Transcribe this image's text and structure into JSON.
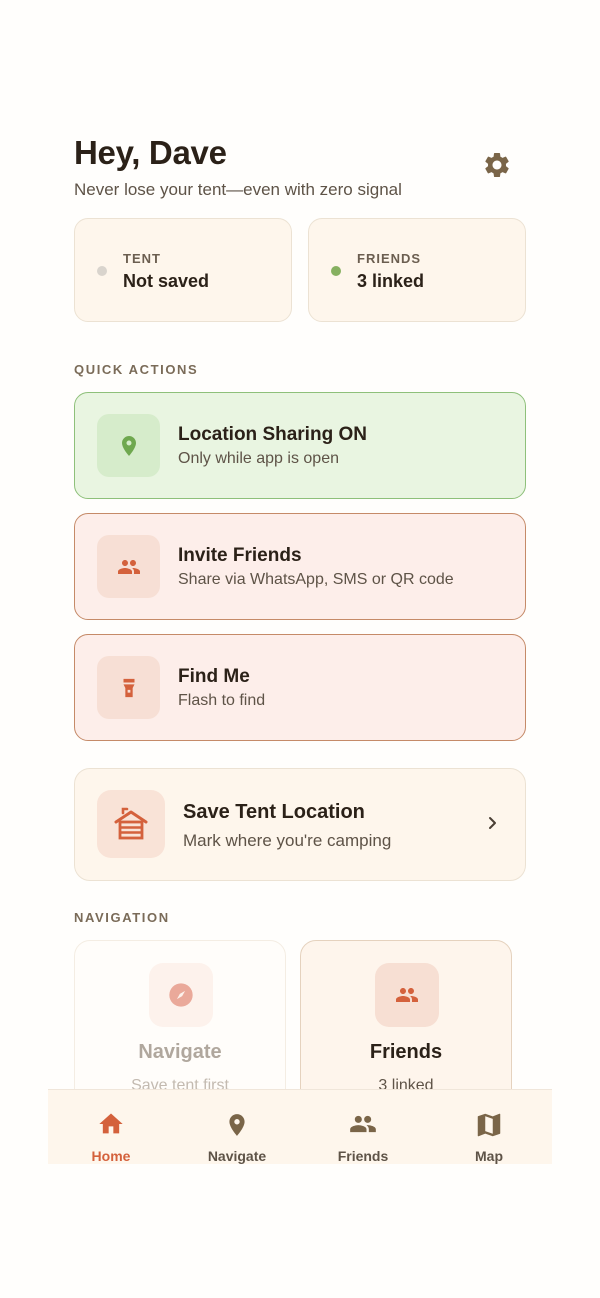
{
  "header": {
    "greeting": "Hey, Dave",
    "subtitle": "Never lose your tent—even with zero signal",
    "settings_icon": "gear-icon"
  },
  "status": {
    "tent": {
      "label": "TENT",
      "value": "Not saved",
      "dot_color": "#d9d4cd"
    },
    "friends": {
      "label": "FRIENDS",
      "value": "3 linked",
      "dot_color": "#86b060"
    }
  },
  "quick_actions": {
    "section_title": "QUICK ACTIONS",
    "items": [
      {
        "icon": "map-pin-icon",
        "title": "Location Sharing ON",
        "desc": "Only while app is open"
      },
      {
        "icon": "people-icon",
        "title": "Invite Friends",
        "desc": "Share via WhatsApp, SMS or QR code"
      },
      {
        "icon": "flashlight-icon",
        "title": "Find Me",
        "desc": "Flash to find"
      }
    ]
  },
  "save_tent": {
    "icon": "cabin-icon",
    "title": "Save Tent Location",
    "desc": "Mark where you're camping"
  },
  "navigation": {
    "section_title": "NAVIGATION",
    "cards": [
      {
        "icon": "compass-icon",
        "title": "Navigate",
        "desc": "Save tent first",
        "enabled": false
      },
      {
        "icon": "people-icon",
        "title": "Friends",
        "desc": "3 linked",
        "enabled": true
      }
    ]
  },
  "bottom_nav": {
    "active": "Home",
    "tabs": [
      {
        "icon": "home-icon",
        "label": "Home"
      },
      {
        "icon": "map-pin-icon",
        "label": "Navigate"
      },
      {
        "icon": "people-icon",
        "label": "Friends"
      },
      {
        "icon": "map-icon",
        "label": "Map"
      }
    ]
  },
  "colors": {
    "accent": "#d4613c",
    "green": "#6fa84f",
    "brown": "#7a6548",
    "text": "#2b2118"
  }
}
